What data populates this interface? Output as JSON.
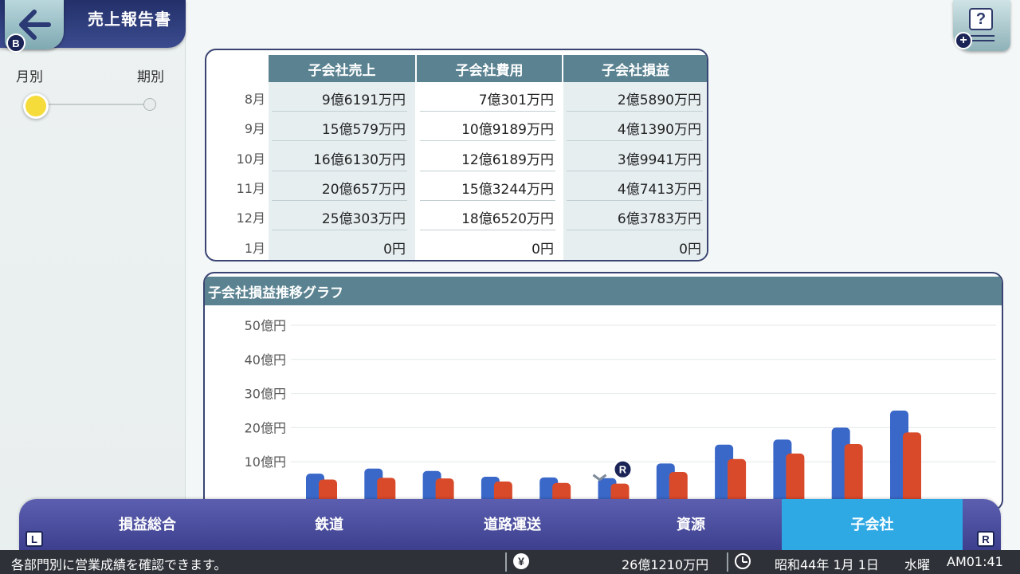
{
  "header": {
    "title": "売上報告書",
    "back_badge": "B",
    "help_glyph": "?",
    "help_plus": "+"
  },
  "mode": {
    "left_label": "月別",
    "right_label": "期別",
    "selected": "月別"
  },
  "table": {
    "columns": [
      "子会社売上",
      "子会社費用",
      "子会社損益"
    ],
    "rows": [
      {
        "month": "8月",
        "values": [
          "9億6191万円",
          "7億301万円",
          "2億5890万円"
        ]
      },
      {
        "month": "9月",
        "values": [
          "15億579万円",
          "10億9189万円",
          "4億1390万円"
        ]
      },
      {
        "month": "10月",
        "values": [
          "16億6130万円",
          "12億6189万円",
          "3億9941万円"
        ]
      },
      {
        "month": "11月",
        "values": [
          "20億657万円",
          "15億3244万円",
          "4億7413万円"
        ]
      },
      {
        "month": "12月",
        "values": [
          "25億303万円",
          "18億6520万円",
          "6億3783万円"
        ]
      },
      {
        "month": "1月",
        "values": [
          "0円",
          "0円",
          "0円"
        ]
      }
    ]
  },
  "chart": {
    "title": "子会社損益推移グラフ",
    "marker_badge": "R"
  },
  "chart_data": {
    "type": "bar",
    "ylim": [
      0,
      50
    ],
    "y_ticks": [
      "50億円",
      "40億円",
      "30億円",
      "20億円",
      "10億円"
    ],
    "y_tick_values": [
      50,
      40,
      30,
      20,
      10
    ],
    "grid": true,
    "series": [
      {
        "values": [
          6.5,
          8,
          7.3,
          5.6,
          5.4,
          5.2,
          9.5,
          15,
          16.5,
          20,
          25
        ],
        "color": "#3a68c9"
      },
      {
        "values": [
          4.8,
          5.3,
          5.1,
          4.2,
          3.8,
          3.6,
          7,
          10.8,
          12.4,
          15.2,
          18.6
        ],
        "color": "#d94a2b"
      }
    ]
  },
  "tabs": [
    {
      "label": "損益総合",
      "active": false
    },
    {
      "label": "鉄道",
      "active": false
    },
    {
      "label": "道路運送",
      "active": false
    },
    {
      "label": "資源",
      "active": false
    },
    {
      "label": "子会社",
      "active": true
    }
  ],
  "tab_badges": {
    "left": "L",
    "right": "R"
  },
  "status": {
    "message": "各部門別に営業成績を確認できます。",
    "money_icon": "¥",
    "money": "26億1210万円",
    "date": "昭和44年 1月 1日",
    "weekday": "水曜",
    "time": "AM01:41"
  }
}
